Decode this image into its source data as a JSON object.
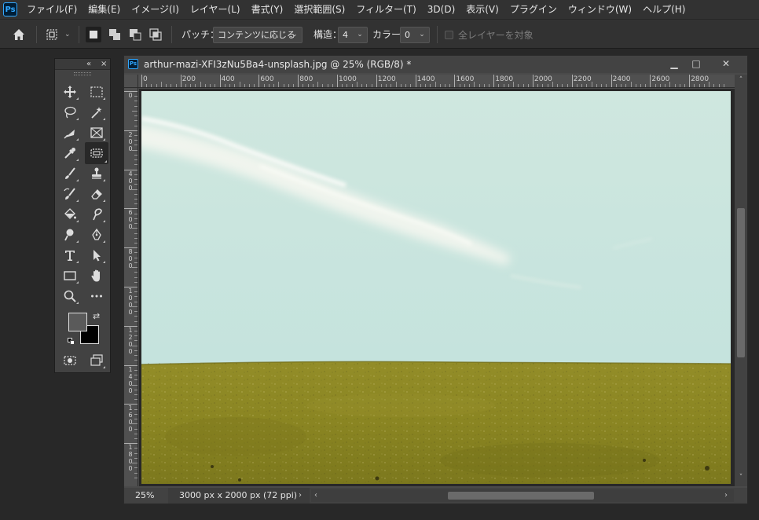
{
  "app": {
    "logo": "Ps",
    "menu": [
      "ファイル(F)",
      "編集(E)",
      "イメージ(I)",
      "レイヤー(L)",
      "書式(Y)",
      "選択範囲(S)",
      "フィルター(T)",
      "3D(D)",
      "表示(V)",
      "プラグイン",
      "ウィンドウ(W)",
      "ヘルプ(H)"
    ]
  },
  "options": {
    "patch_label": "パッチ：",
    "patch_value": "コンテンツに応じる",
    "structure_label": "構造：",
    "structure_value": "4",
    "color_label": "カラー：",
    "color_value": "0",
    "sample_all_layers": "全レイヤーを対象",
    "sample_all_layers_checked": false
  },
  "tools_panel": {
    "collapse": "«",
    "close": "×",
    "foreground_color": "#5a5a5a",
    "background_color": "#000000"
  },
  "document": {
    "ps_icon": "Ps",
    "title": "arthur-mazi-XFI3zNu5Ba4-unsplash.jpg @ 25% (RGB/8) *",
    "minimize": "▁",
    "maximize": "□",
    "close": "✕",
    "ruler_h_labels": [
      "0",
      "200",
      "400",
      "600",
      "800",
      "1000",
      "1200",
      "1400",
      "1600",
      "1800",
      "2000",
      "2200",
      "2400",
      "2600",
      "2800"
    ],
    "ruler_v_labels": [
      "0",
      "200",
      "400",
      "600",
      "800",
      "1000",
      "1200",
      "1400",
      "1600",
      "1800"
    ],
    "zoom": "25%",
    "info": "3000 px x 2000 px (72 ppi)",
    "info_arrow": "›",
    "scroll_left": "‹",
    "scroll_right": "›",
    "scroll_up": "˄",
    "scroll_down": "˅"
  },
  "colors": {
    "sky_top": "#cde6de",
    "sky_bottom": "#c2e2dc",
    "grass_top": "#8f8a24",
    "grass_bottom": "#7e7a1e",
    "accent": "#31a8ff"
  }
}
